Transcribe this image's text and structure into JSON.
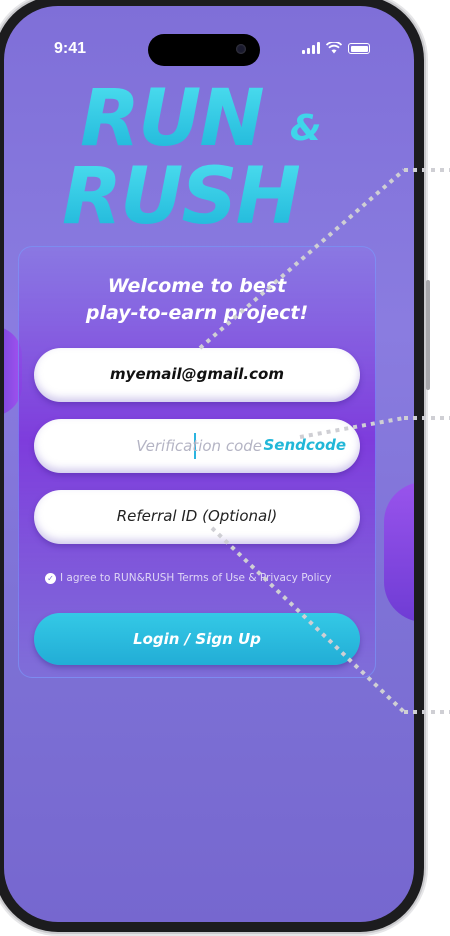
{
  "status_bar": {
    "time": "9:41"
  },
  "logo": {
    "line1": "RUN",
    "amp": "&",
    "line2": "RUSH"
  },
  "card": {
    "title_line1": "Welcome to best",
    "title_line2": "play-to-earn project!",
    "email": {
      "value": "myemail@gmail.com"
    },
    "verification": {
      "placeholder": "Verification code",
      "send_label": "Sendcode"
    },
    "referral": {
      "placeholder": "Referral ID (Optional)"
    },
    "agree_text": "I agree to RUN&RUSH Terms of Use & Privacy Policy",
    "login_label": "Login / Sign Up"
  },
  "colors": {
    "accent": "#22b7d8",
    "background": "#8a7ce0",
    "card_purple": "#7d32dc"
  }
}
